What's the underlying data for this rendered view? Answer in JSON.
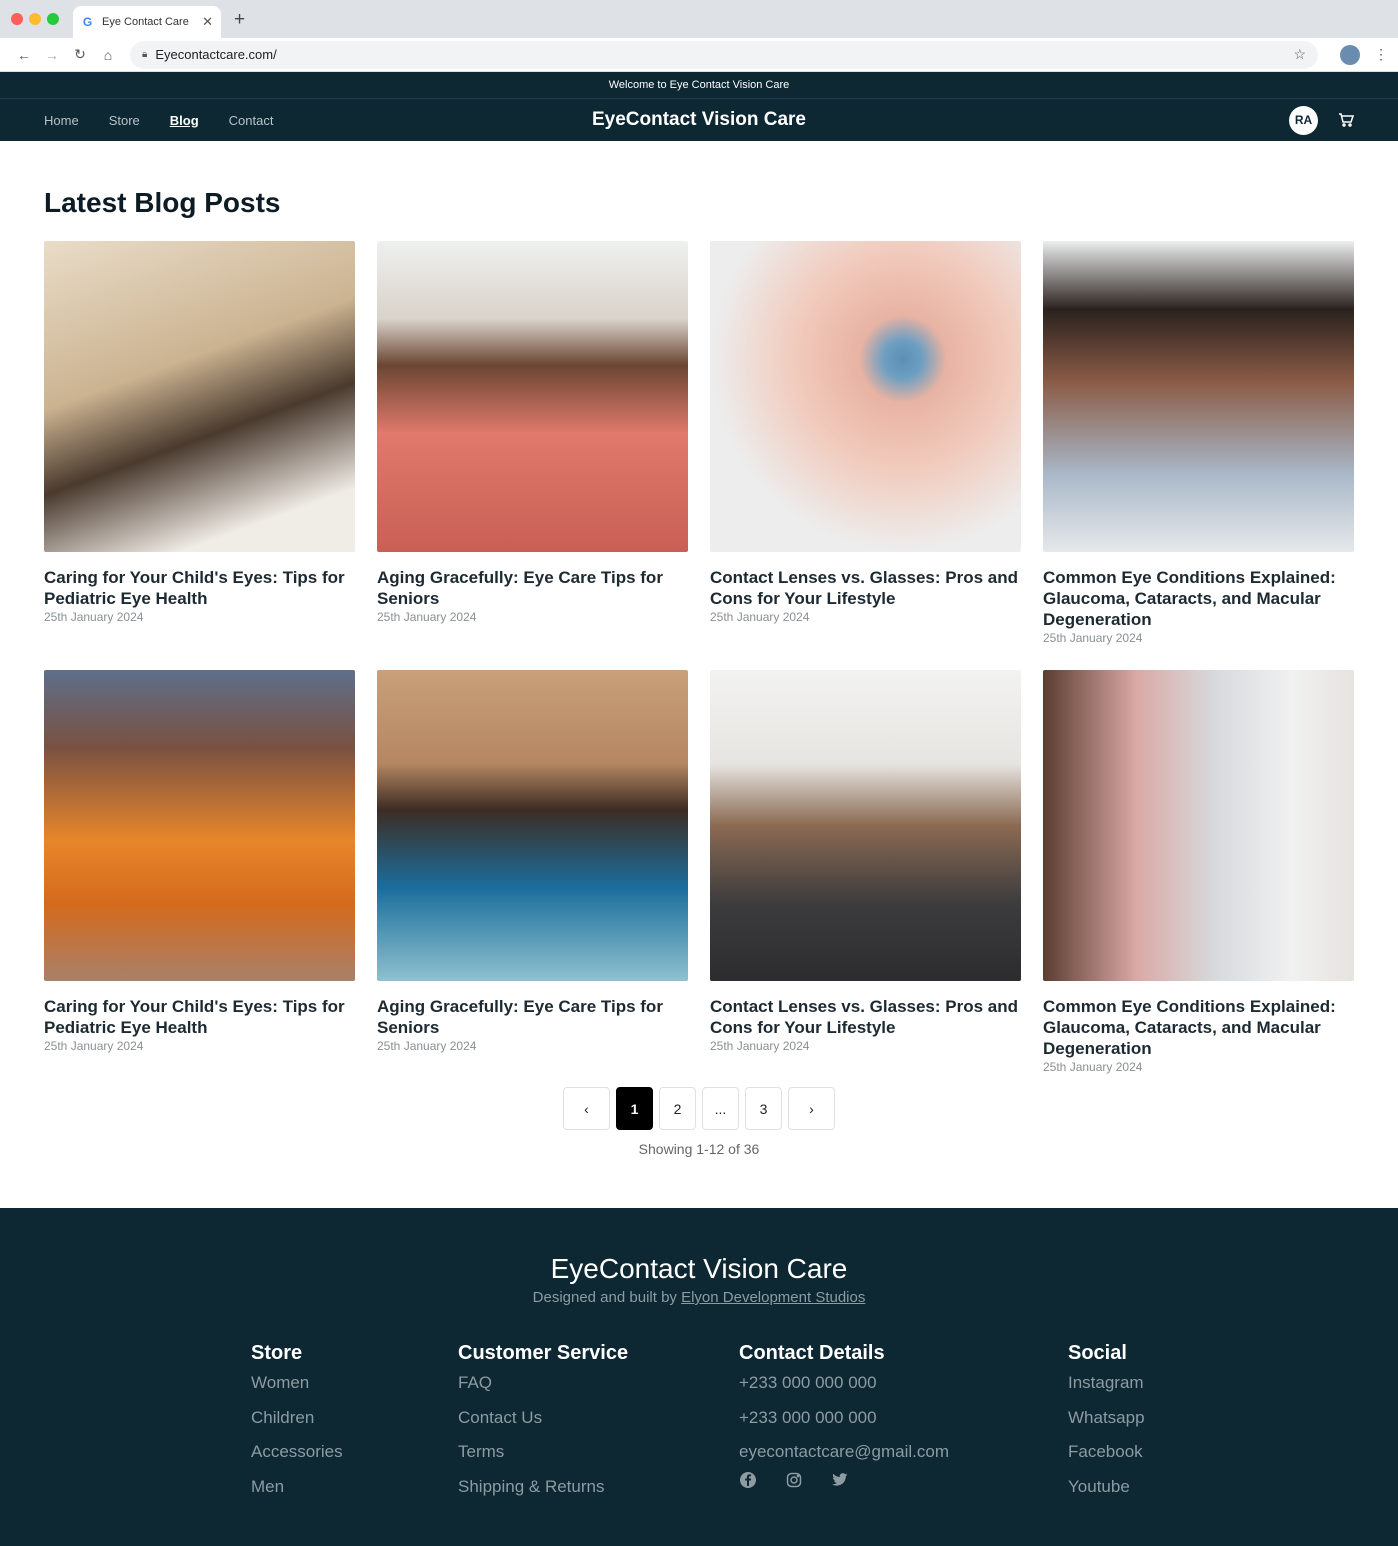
{
  "browser": {
    "tab_title": "Eye Contact Care",
    "url": "Eyecontactcare.com/"
  },
  "site": {
    "welcome": "Welcome to Eye Contact Vision Care",
    "brand": "EyeContact Vision Care",
    "nav": [
      "Home",
      "Store",
      "Blog",
      "Contact"
    ],
    "active_nav": "Blog",
    "avatar_initials": "RA"
  },
  "blog": {
    "heading": "Latest Blog Posts",
    "posts": [
      {
        "title": "Caring for Your Child's Eyes: Tips for Pediatric Eye Health",
        "date": "25th January 2024"
      },
      {
        "title": "Aging Gracefully: Eye Care Tips for Seniors",
        "date": "25th January 2024"
      },
      {
        "title": "Contact Lenses vs. Glasses: Pros and Cons for Your Lifestyle",
        "date": "25th January 2024"
      },
      {
        "title": "Common Eye Conditions Explained: Glaucoma, Cataracts, and Macular Degeneration",
        "date": "25th January 2024"
      },
      {
        "title": "Caring for Your Child's Eyes: Tips for Pediatric Eye Health",
        "date": "25th January 2024"
      },
      {
        "title": "Aging Gracefully: Eye Care Tips for Seniors",
        "date": "25th January 2024"
      },
      {
        "title": "Contact Lenses vs. Glasses: Pros and Cons for Your Lifestyle",
        "date": "25th January 2024"
      },
      {
        "title": "Common Eye Conditions Explained: Glaucoma, Cataracts, and Macular Degeneration",
        "date": "25th January 2024"
      }
    ]
  },
  "pagination": {
    "prev": "‹",
    "pages": [
      "1",
      "2",
      "...",
      "3"
    ],
    "current": "1",
    "next": "›",
    "showing": "Showing 1-12 of 36"
  },
  "footer": {
    "brand": "EyeContact Vision Care",
    "credit_prefix": "Designed and built by ",
    "credit_link": "Elyon Development Studios",
    "columns": [
      {
        "title": "Store",
        "items": [
          "Women",
          "Children",
          "Accessories",
          "Men"
        ]
      },
      {
        "title": "Customer Service",
        "items": [
          "FAQ",
          "Contact Us",
          "Terms",
          "Shipping & Returns"
        ]
      },
      {
        "title": "Contact Details",
        "items": [
          "+233 000 000 000",
          "+233 000 000 000",
          "eyecontactcare@gmail.com"
        ]
      },
      {
        "title": "Social",
        "items": [
          "Instagram",
          "Whatsapp",
          "Facebook",
          "Youtube"
        ]
      }
    ],
    "social_icons": [
      "facebook-icon",
      "instagram-icon",
      "twitter-icon"
    ]
  },
  "colors": {
    "header_bg": "#0d2733",
    "footer_bg": "#0d2733",
    "active_page": "#000000"
  }
}
